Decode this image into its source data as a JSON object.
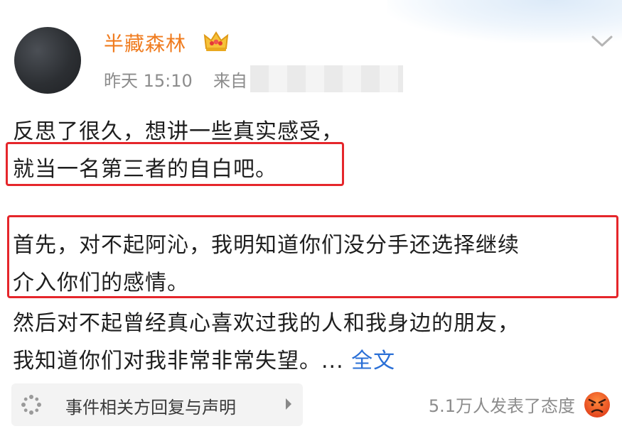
{
  "post": {
    "username": "半藏森林",
    "time": "昨天 15:10",
    "source_prefix": "来自",
    "lines": [
      "反思了很久，想讲一些真实感受，",
      "就当一名第三者的自白吧。",
      "首先，对不起阿沁，我明知道你们没分手还选择继续",
      "介入你们的感情。",
      "然后对不起曾经真心喜欢过我的人和我身边的朋友，",
      "我知道你们对我非常非常失望。..."
    ],
    "full_text_link": "全文"
  },
  "topic": {
    "label": "事件相关方回复与声明"
  },
  "reactions": {
    "text": "5.1万人发表了态度"
  },
  "icons": {
    "crown": "crown-icon",
    "chevron": "chevron-down-icon",
    "topic": "topic-icon",
    "reaction": "angry-face-icon"
  },
  "colors": {
    "username": "#f07c1f",
    "highlight": "#e5262b",
    "link": "#2a6fd6",
    "meta": "#8c8c8c"
  }
}
